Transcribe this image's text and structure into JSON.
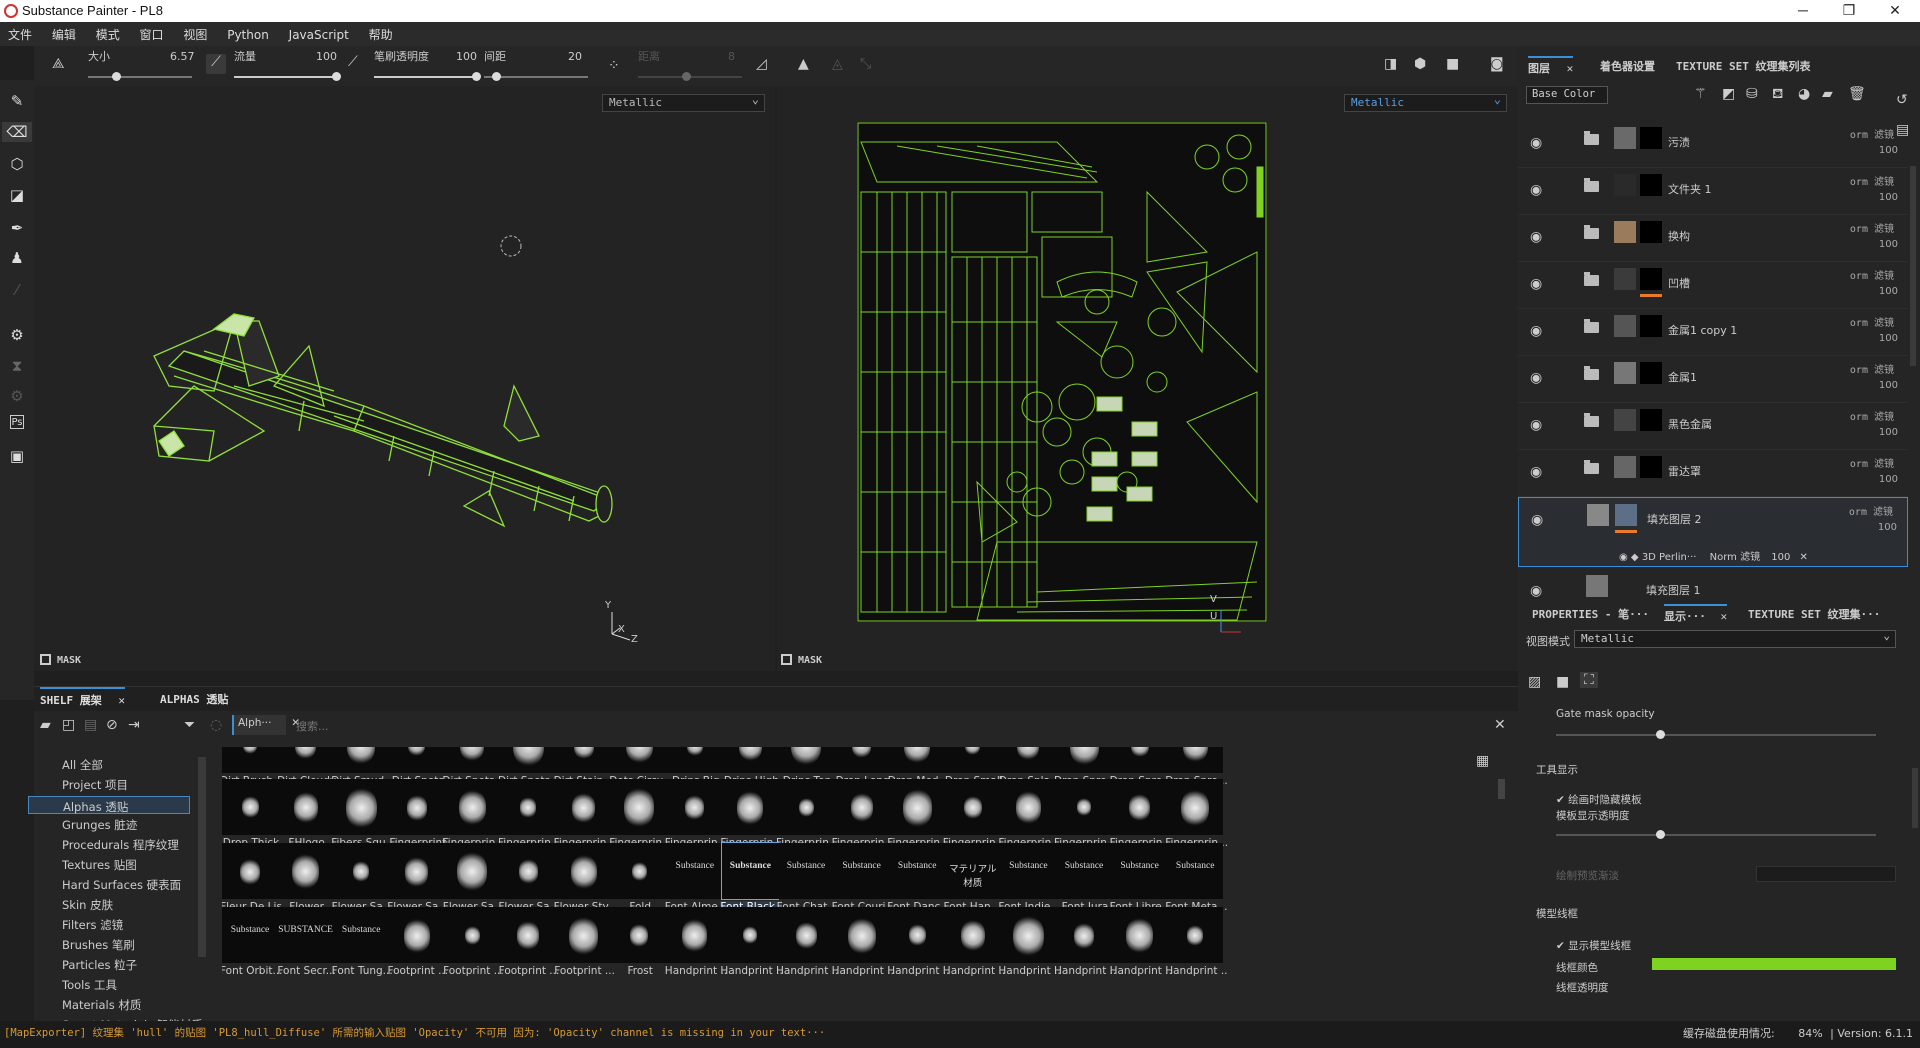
{
  "window": {
    "title": "Substance Painter - PL8",
    "minimize": "─",
    "maximize": "❐",
    "close": "✕"
  },
  "menu": [
    "文件",
    "编辑",
    "模式",
    "窗口",
    "视图",
    "Python",
    "JavaScript",
    "帮助"
  ],
  "toolbar": {
    "size_label": "大小",
    "size_value": "6.57",
    "flow_label": "流量",
    "flow_value": "100",
    "opacity_label": "笔刷透明度",
    "opacity_value": "100",
    "spacing_label": "间距",
    "spacing_value": "20",
    "distance_label": "距离",
    "distance_value": "8"
  },
  "viewport": {
    "left_channel": "Metallic",
    "right_channel": "Metallic",
    "mask_label": "MASK",
    "axis_y": "Y",
    "axis_x": "X",
    "axis_z": "Z",
    "axis_v": "V",
    "axis_u": "U"
  },
  "shelf": {
    "tab_shelf": "SHELF 展架",
    "tab_alphas": "ALPHAS 透贴",
    "filter_chip": "Alph···",
    "search_placeholder": "搜索...",
    "categories": [
      "All 全部",
      "Project 项目",
      "Alphas 透贴",
      "Grunges 脏迹",
      "Procedurals 程序纹理",
      "Textures 贴图",
      "Hard Surfaces 硬表面",
      "Skin 皮肤",
      "Filters 滤镜",
      "Brushes 笔刷",
      "Particles 粒子",
      "Tools 工具",
      "Materials 材质",
      "Smart Materials 智能材质"
    ],
    "selected_category": "Alphas 透贴",
    "rows": [
      [
        "Dirt Brush...",
        "Dirt Cloudy",
        "Dirt Smud...",
        "Dirt Spots",
        "Dirt Spots...",
        "Dirt Spots...",
        "Dirt Stain ...",
        "Dots Circu...",
        "Drips Big",
        "Drips High",
        "Drips Top",
        "Drop Long",
        "Drop Med...",
        "Drop Small",
        "Drop Spla...",
        "Drop Spre...",
        "Drop Spre...",
        "Drop Spre..."
      ],
      [
        "Drop Thick",
        "FHlogo",
        "Fibers Squ...",
        "Fingerprint",
        "Fingerprin...",
        "Fingerprin...",
        "Fingerprin...",
        "Fingerprin...",
        "Fingerprin...",
        "Fingerprin...",
        "Fingerprin...",
        "Fingerprin...",
        "Fingerprin...",
        "Fingerprin...",
        "Fingerprin...",
        "Fingerprin...",
        "Fingerprin...",
        "Fingerprin..."
      ],
      [
        "Fleur De Lis",
        "Flower",
        "Flower Sa...",
        "Flower Sa...",
        "Flower Sa...",
        "Flower Sa...",
        "Flower Sty...",
        "Fold",
        "Font Alme...",
        "Font Black...",
        "Font Chat...",
        "Font Couri...",
        "Font Danc...",
        "Font Han ...",
        "Font Indie ...",
        "Font Jura",
        "Font Libre ...",
        "Font Meta..."
      ],
      [
        "Font Orbit...",
        "Font Secr...",
        "Font Tung...",
        "Footprint ...",
        "Footprint ...",
        "Footprint ...",
        "Footprint ...",
        "Frost",
        "Handprint ...",
        "Handprint ...",
        "Handprint ...",
        "Handprint ...",
        "Handprint ...",
        "Handprint ...",
        "Handprint ...",
        "Handprint ...",
        "Handprint ...",
        "Handprint ..."
      ]
    ],
    "font_thumbs": {
      "r2_8": "Substance",
      "r2_9": "Substance",
      "r2_10": "Substance",
      "r2_11": "Substance",
      "r2_12": "Substance",
      "r2_13": "マテリアル 材质",
      "r2_14": "Substance",
      "r2_15": "Substance",
      "r2_16": "Substance",
      "r2_17": "Substance",
      "r3_0": "Substance",
      "r3_1": "SUBSTANCE",
      "r3_2": "Substance"
    }
  },
  "layers_panel": {
    "tab_layers": "图层",
    "tab_shader": "着色器设置",
    "tab_textureset": "TEXTURE SET 纹理集列表",
    "channel": "Base Color",
    "layers": [
      {
        "name": "污渍",
        "blend": "orm 滤镜",
        "opacity": "100"
      },
      {
        "name": "文件夹 1",
        "blend": "orm 滤镜",
        "opacity": "100"
      },
      {
        "name": "换构",
        "blend": "orm 滤镜",
        "opacity": "100"
      },
      {
        "name": "凹槽",
        "blend": "orm 滤镜",
        "opacity": "100"
      },
      {
        "name": "金属1 copy 1",
        "blend": "orm 滤镜",
        "opacity": "100"
      },
      {
        "name": "金属1",
        "blend": "orm 滤镜",
        "opacity": "100"
      },
      {
        "name": "黑色金属",
        "blend": "orm 滤镜",
        "opacity": "100"
      },
      {
        "name": "雷达罩",
        "blend": "orm 滤镜",
        "opacity": "100"
      },
      {
        "name": "填充图层 2",
        "blend": "orm 滤镜",
        "opacity": "100"
      }
    ],
    "effect": {
      "name": "3D Perlin···",
      "blend": "Norm 滤镜",
      "opacity": "100"
    },
    "partial_layer": "填充图层 1"
  },
  "properties_panel": {
    "tab_properties": "PROPERTIES - 笔···",
    "tab_display": "显示···",
    "tab_textureset": "TEXTURE SET 纹理集···",
    "view_mode_label": "视图模式",
    "view_mode_value": "Metallic",
    "gate_mask_opacity": "Gate mask opacity",
    "tool_display": "工具显示",
    "hide_template": "绘画时隐藏模板",
    "template_opacity": "模板显示透明度",
    "preview_fade": "绘制预览渐淡",
    "model_wireframe": "模型线框",
    "show_wireframe": "显示模型线框",
    "wire_color_label": "线框颜色",
    "wire_opacity_label": "线框透明度",
    "wire_color": "#7ed321"
  },
  "status": {
    "message": "[MapExporter] 纹理集 'hull' 的贴图 'PL8_hull_Diffuse' 所需的输入贴图 'Opacity' 不可用 因为: 'Opacity' channel is missing in your text···",
    "cache_label": "缓存磁盘使用情况:",
    "cache_value": "84%",
    "version": "Version: 6.1.1"
  },
  "colors": {
    "accent": "#3a8fd6",
    "wire_green": "#7ed321",
    "status_warning": "#d79a35",
    "orange_mark": "#e87a2a"
  }
}
